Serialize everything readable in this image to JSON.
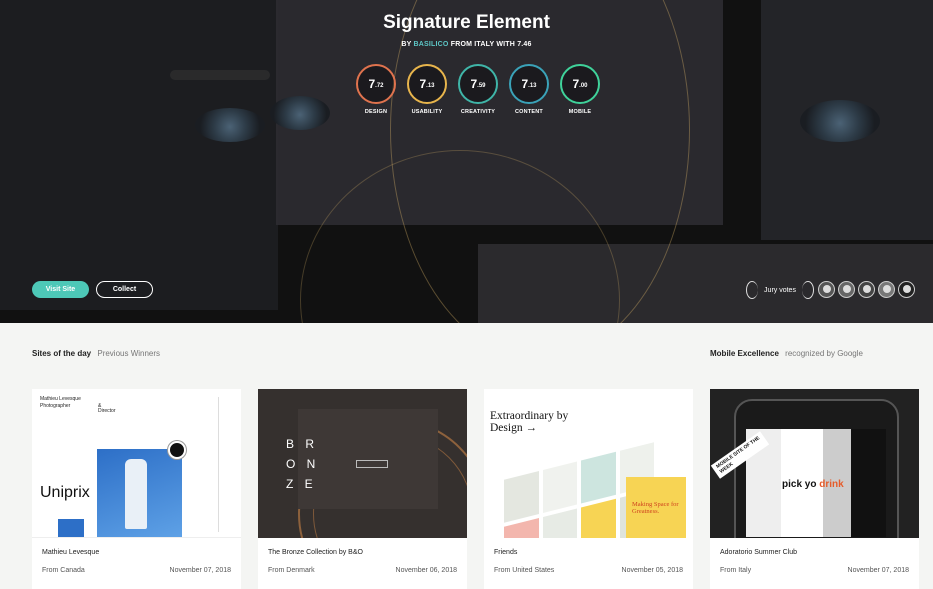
{
  "hero": {
    "title": "Signature Element",
    "byline_prefix": "BY",
    "author": "BASILICO",
    "byline_mid": "FROM ITALY WITH",
    "overall_score": "7.46",
    "scores": [
      {
        "major": "7",
        "minor": ".72",
        "label": "DESIGN",
        "color": "#e0734e"
      },
      {
        "major": "7",
        "minor": ".13",
        "label": "USABILITY",
        "color": "#e8b54c"
      },
      {
        "major": "7",
        "minor": ".59",
        "label": "CREATIVITY",
        "color": "#3fb5a8"
      },
      {
        "major": "7",
        "minor": ".13",
        "label": "CONTENT",
        "color": "#3aa2b8"
      },
      {
        "major": "7",
        "minor": ".00",
        "label": "MOBILE",
        "color": "#3fd29a"
      }
    ],
    "visit_label": "Visit Site",
    "collect_label": "Collect",
    "jury_label": "Jury votes"
  },
  "sections": {
    "sites_of_day": "Sites of the day",
    "previous_winners": "Previous Winners",
    "mobile_excellence": "Mobile Excellence",
    "recognized_by": "recognized by Google"
  },
  "cards": [
    {
      "title": "Mathieu Levesque",
      "from": "From Canada",
      "date": "November 07, 2018",
      "thumb_text": {
        "name": "Mathieu Levesque",
        "role": "Photographer",
        "amp": "&",
        "role2": "Director",
        "brand": "Uniprix"
      }
    },
    {
      "title": "The Bronze Collection by B&O",
      "from": "From Denmark",
      "date": "November 06, 2018",
      "thumb_text": {
        "l1": "B  R",
        "l2": "O  N",
        "l3": "Z  E"
      }
    },
    {
      "title": "Friends",
      "from": "From United States",
      "date": "November 05, 2018",
      "thumb_text": {
        "heading": "Extraordinary by Design →",
        "cta": "Making Space for Greatness."
      }
    },
    {
      "title": "Adoratorio Summer Club",
      "from": "From Italy",
      "date": "November 07, 2018",
      "thumb_text": {
        "badge": "MOBILE SITE OF THE WEEK",
        "phrase_a": "pick yo ",
        "phrase_b": "drink"
      }
    }
  ]
}
